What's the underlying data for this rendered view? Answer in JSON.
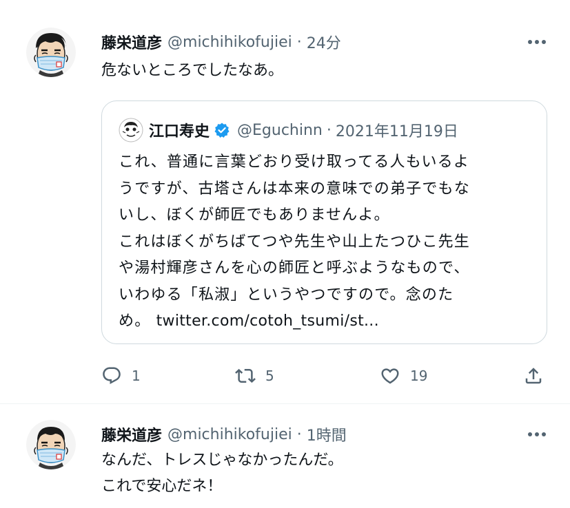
{
  "tweets": [
    {
      "name": "藤栄道彦",
      "handle": "@michihikofujiei",
      "separator": "·",
      "time": "24分",
      "text_lines": [
        "危ないところでしたなあ。"
      ],
      "quote": {
        "name": "江口寿史",
        "verified": true,
        "handle": "@Eguchinn",
        "separator": "·",
        "date": "2021年11月19日",
        "text_lines": [
          "これ、普通に言葉どおり受け取ってる人もいるよ",
          "うですが、古塔さんは本来の意味での弟子でもな",
          "いし、ぼくが師匠でもありませんよ。",
          "これはぼくがちばてつや先生や山上たつひこ先生",
          "や湯村輝彦さんを心の師匠と呼ぶようなもので、",
          "いわゆる「私淑」というやつですので。念のた"
        ],
        "last_line_prefix": "め。",
        "link": "twitter.com/cotoh_tsumi/st..."
      },
      "actions": {
        "replies": "1",
        "retweets": "5",
        "likes": "19"
      }
    },
    {
      "name": "藤栄道彦",
      "handle": "@michihikofujiei",
      "separator": "·",
      "time": "1時間",
      "text_lines": [
        "なんだ、トレスじゃなかったんだ。",
        "これで安心だネ！"
      ]
    }
  ],
  "icons": {
    "more": "more-horizontal-icon",
    "reply": "reply-icon",
    "retweet": "retweet-icon",
    "like": "heart-icon",
    "share": "share-icon",
    "verified": "verified-badge-icon"
  },
  "colors": {
    "text": "#0f1419",
    "secondary": "#536471",
    "border": "#cfd9de",
    "verified": "#1d9bf0"
  }
}
